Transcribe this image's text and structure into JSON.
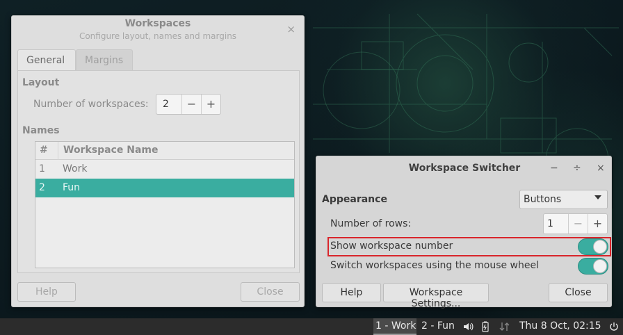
{
  "workspaces_window": {
    "title": "Workspaces",
    "subtitle": "Configure layout, names and margins",
    "close_glyph": "×",
    "tabs": [
      {
        "label": "General"
      },
      {
        "label": "Margins"
      }
    ],
    "layout_section": "Layout",
    "num_workspaces_label": "Number of workspaces:",
    "num_workspaces_value": "2",
    "minus": "−",
    "plus": "+",
    "names_section": "Names",
    "table": {
      "columns": [
        "#",
        "Workspace Name"
      ],
      "rows": [
        {
          "num": "1",
          "name": "Work"
        },
        {
          "num": "2",
          "name": "Fun"
        }
      ],
      "selected_row": 2
    },
    "help_label": "Help",
    "close_label": "Close"
  },
  "switcher_window": {
    "title": "Workspace Switcher",
    "wm_minimize": "−",
    "wm_maximize": "÷",
    "wm_close": "×",
    "appearance_label": "Appearance",
    "appearance_value": "Buttons",
    "rows_label": "Number of rows:",
    "rows_value": "1",
    "minus": "−",
    "plus": "+",
    "show_number_label": "Show workspace number",
    "show_number_on": true,
    "mouse_wheel_label": "Switch workspaces using the mouse wheel",
    "mouse_wheel_on": true,
    "help_label": "Help",
    "settings_label": "Workspace Settings...",
    "close_label": "Close"
  },
  "panel": {
    "workspace_buttons": [
      "1 - Work",
      "2 - Fun"
    ],
    "active_workspace": "1 - Work",
    "icons": [
      "volume-icon",
      "battery-icon",
      "network-icon"
    ],
    "clock": "Thu  8 Oct, 02:15"
  },
  "colors": {
    "accent": "#3aada0",
    "highlight": "#d9252b",
    "panel_bg": "#2c2c2c"
  }
}
